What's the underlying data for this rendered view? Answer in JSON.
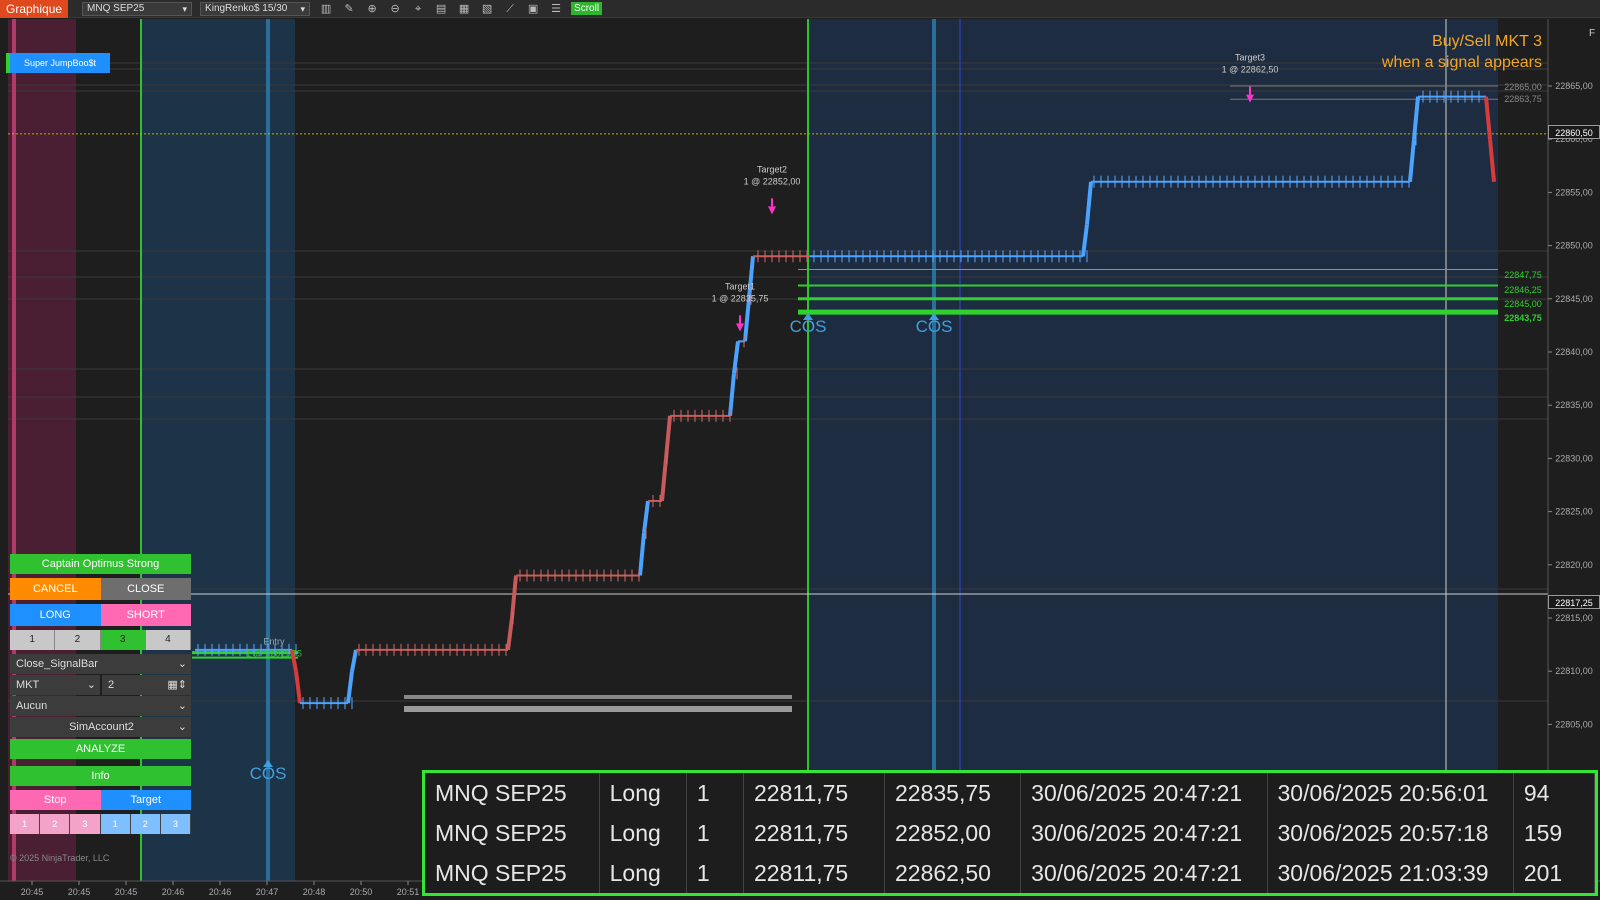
{
  "toolbar": {
    "title": "Graphique",
    "instrument": "MNQ SEP25",
    "bar_type": "KingRenko$ 15/30",
    "scroll_label": "Scroll"
  },
  "chart": {
    "indicator_label": "Super JumpBoo$t",
    "annotation_line1": "Buy/Sell MKT 3",
    "annotation_line2": "when a signal appears",
    "price_axis": [
      "22865,00",
      "22860,00",
      "22855,00",
      "22850,00",
      "22845,00",
      "22840,00",
      "22835,00",
      "22830,00",
      "22825,00",
      "22820,00",
      "22815,00",
      "22810,00",
      "22805,00"
    ],
    "price_tags": {
      "current": "22860,50",
      "crosshair": "22817,25",
      "green1": "22847,75",
      "green2": "22846,25",
      "green3": "22845,00",
      "green4": "22843,75",
      "gray1": "22865,00",
      "gray2": "22863,75"
    },
    "time_axis": [
      "20:45",
      "20:45",
      "20:45",
      "20:46",
      "20:46",
      "20:47",
      "20:48",
      "20:50",
      "20:51"
    ],
    "targets": [
      {
        "name": "Target1",
        "detail": "1 @ 22835,75"
      },
      {
        "name": "Target2",
        "detail": "1 @ 22852,00"
      },
      {
        "name": "Target3",
        "detail": "1 @ 22862,50"
      }
    ],
    "entry": {
      "name": "Entry",
      "detail": "1 @ 22811,75"
    },
    "signal_label": "COS",
    "corner_letter": "F"
  },
  "panel": {
    "strategy": "Captain Optimus Strong",
    "cancel": "CANCEL",
    "close": "CLOSE",
    "long": "LONG",
    "short": "SHORT",
    "qty_buttons": [
      "1",
      "2",
      "3",
      "4"
    ],
    "close_mode": "Close_SignalBar",
    "order_type": "MKT",
    "quantity": "2",
    "option": "Aucun",
    "account": "SimAccount2",
    "analyze": "ANALYZE",
    "info": "Info",
    "stop": "Stop",
    "target": "Target",
    "stop_buttons": [
      "1",
      "2",
      "3"
    ],
    "target_buttons": [
      "1",
      "2",
      "3"
    ]
  },
  "copyright": "© 2025 NinjaTrader, LLC",
  "trades": [
    {
      "instrument": "MNQ SEP25",
      "side": "Long",
      "qty": "1",
      "entry": "22811,75",
      "exit": "22835,75",
      "entry_time": "30/06/2025 20:47:21",
      "exit_time": "30/06/2025 20:56:01",
      "profit": "94"
    },
    {
      "instrument": "MNQ SEP25",
      "side": "Long",
      "qty": "1",
      "entry": "22811,75",
      "exit": "22852,00",
      "entry_time": "30/06/2025 20:47:21",
      "exit_time": "30/06/2025 20:57:18",
      "profit": "159"
    },
    {
      "instrument": "MNQ SEP25",
      "side": "Long",
      "qty": "1",
      "entry": "22811,75",
      "exit": "22862,50",
      "entry_time": "30/06/2025 20:47:21",
      "exit_time": "30/06/2025 21:03:39",
      "profit": "201"
    }
  ]
}
